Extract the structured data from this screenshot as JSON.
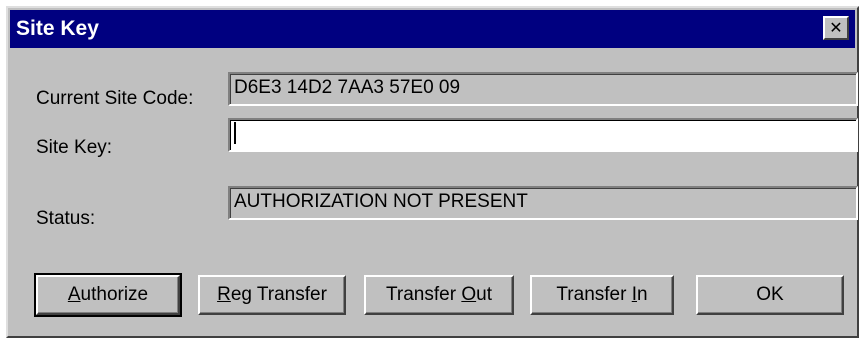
{
  "window": {
    "title": "Site Key",
    "close_glyph": "✕"
  },
  "fields": {
    "current_site_code": {
      "label": "Current Site Code:",
      "value": "D6E3 14D2 7AA3 57E0 09"
    },
    "site_key": {
      "label": "Site Key:",
      "value": ""
    },
    "status": {
      "label": "Status:",
      "value": "AUTHORIZATION NOT PRESENT"
    }
  },
  "buttons": {
    "authorize": {
      "mnemonic": "A",
      "rest": "uthorize"
    },
    "reg_transfer": {
      "mnemonic": "R",
      "rest": "eg Transfer"
    },
    "transfer_out": {
      "pre": "Transfer ",
      "mnemonic": "O",
      "rest": "ut"
    },
    "transfer_in": {
      "pre": "Transfer ",
      "mnemonic": "I",
      "rest": "n"
    },
    "ok": {
      "label": "OK"
    }
  }
}
